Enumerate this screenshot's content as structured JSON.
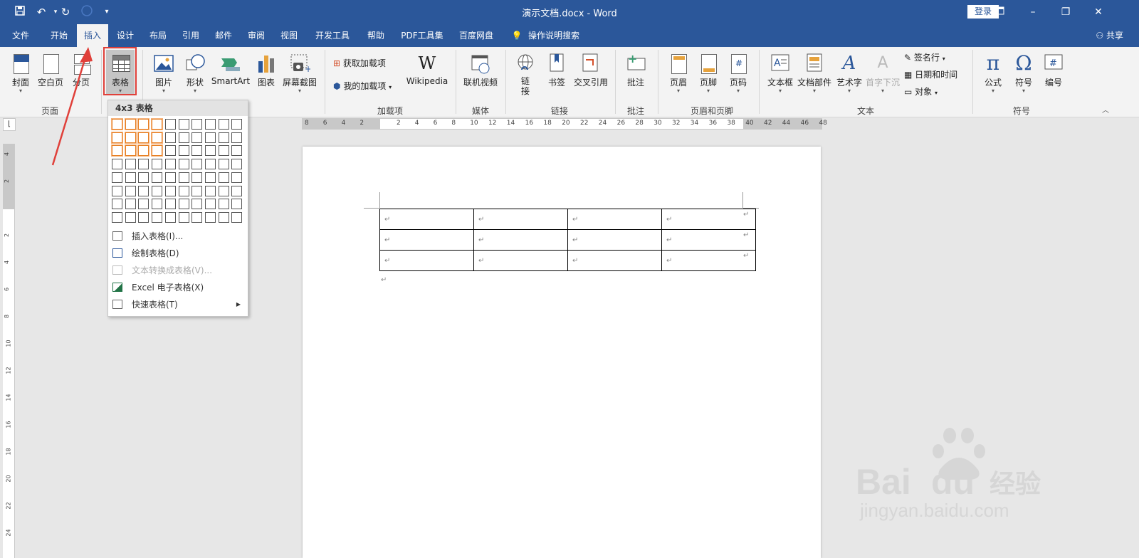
{
  "window": {
    "title": "演示文档.docx  -  Word",
    "login_label": "登录",
    "share_label": "共享"
  },
  "quick_access": [
    "save-icon",
    "undo-icon",
    "redo-icon",
    "touch-mode-icon",
    "customize-icon"
  ],
  "tabs": [
    "文件",
    "开始",
    "插入",
    "设计",
    "布局",
    "引用",
    "邮件",
    "审阅",
    "视图",
    "开发工具",
    "帮助",
    "PDF工具集",
    "百度网盘"
  ],
  "active_tab": "插入",
  "search_label": "操作说明搜索",
  "ribbon": {
    "groups": {
      "pages": {
        "label": "页面",
        "buttons": [
          "封面",
          "空白页",
          "分页"
        ]
      },
      "tables": {
        "button": "表格"
      },
      "illustrations": {
        "buttons": [
          "图片",
          "形状",
          "SmartArt",
          "图表",
          "屏幕截图"
        ]
      },
      "addins": {
        "label": "加载项",
        "get": "获取加载项",
        "my": "我的加载项",
        "wiki": "Wikipedia"
      },
      "media": {
        "label": "媒体",
        "button": "联机视频"
      },
      "links": {
        "label": "链接",
        "buttons": [
          "链\n接",
          "书签",
          "交叉引用"
        ]
      },
      "comments": {
        "label": "批注",
        "button": "批注"
      },
      "header_footer": {
        "label": "页眉和页脚",
        "buttons": [
          "页眉",
          "页脚",
          "页码"
        ]
      },
      "text": {
        "label": "文本",
        "buttons": [
          "文本框",
          "文档部件",
          "艺术字",
          "首字下沉"
        ],
        "small": [
          "签名行",
          "日期和时间",
          "对象"
        ]
      },
      "symbols": {
        "label": "符号",
        "buttons": [
          "公式",
          "符号",
          "编号"
        ]
      }
    }
  },
  "ruler": {
    "h_numbers": [
      "8",
      "6",
      "4",
      "2",
      "",
      "2",
      "4",
      "6",
      "8",
      "10",
      "12",
      "14",
      "16",
      "18",
      "20",
      "22",
      "24",
      "26",
      "28",
      "30",
      "32",
      "34",
      "36",
      "38",
      "40",
      "42",
      "44",
      "46",
      "48"
    ],
    "v_numbers": [
      "4",
      "2",
      "",
      "2",
      "4",
      "6",
      "8",
      "10",
      "12",
      "14",
      "16",
      "18",
      "20",
      "22",
      "24"
    ]
  },
  "insert_table_menu": {
    "header": "4x3 表格",
    "grid_cols": 10,
    "grid_rows": 8,
    "selected_cols": 4,
    "selected_rows": 3,
    "items": [
      {
        "label": "插入表格(I)...",
        "disabled": false
      },
      {
        "label": "绘制表格(D)",
        "disabled": false
      },
      {
        "label": "文本转换成表格(V)...",
        "disabled": true
      },
      {
        "label": "Excel 电子表格(X)",
        "disabled": false
      },
      {
        "label": "快速表格(T)",
        "disabled": false,
        "submenu": true
      }
    ]
  },
  "document": {
    "table_rows": 3,
    "table_cols": 4,
    "cell_mark": "↵"
  },
  "watermark": {
    "brand": "Bai",
    "brand2": "du",
    "cn": "经验",
    "url": "jingyan.baidu.com"
  },
  "colors": {
    "word_blue": "#2b579a",
    "highlight_red": "#e0403a",
    "grid_select": "#e67e22"
  }
}
